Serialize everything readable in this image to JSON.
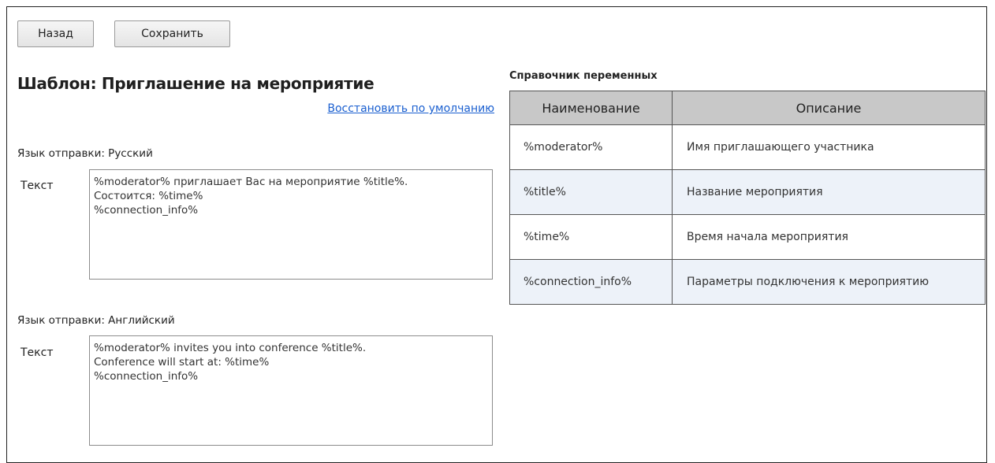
{
  "toolbar": {
    "back_label": "Назад",
    "save_label": "Сохранить"
  },
  "template": {
    "title": "Шаблон: Приглашение на мероприятие",
    "restore_link": "Восстановить по умолчанию"
  },
  "languages": [
    {
      "heading": "Язык отправки: Русский",
      "field_label": "Текст",
      "text": "%moderator% приглашает Вас на мероприятие %title%.\nСостоится: %time%\n%connection_info%"
    },
    {
      "heading": "Язык отправки: Английский",
      "field_label": "Текст",
      "text": "%moderator% invites you into conference %title%.\nConference will start at: %time%\n%connection_info%"
    }
  ],
  "reference": {
    "title": "Справочник переменных",
    "headers": [
      "Наименование",
      "Описание"
    ],
    "rows": [
      {
        "name": "%moderator%",
        "description": "Имя приглашающего участника"
      },
      {
        "name": "%title%",
        "description": "Название мероприятия"
      },
      {
        "name": "%time%",
        "description": "Время начала мероприятия"
      },
      {
        "name": "%connection_info%",
        "description": "Параметры подключения к мероприятию"
      }
    ]
  }
}
